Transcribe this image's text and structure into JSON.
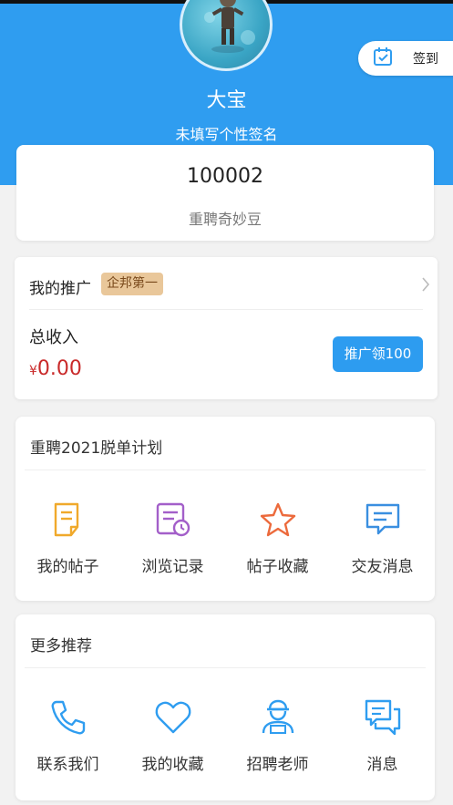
{
  "profile": {
    "nickname": "大宝",
    "signature": "未填写个性签名"
  },
  "signin": {
    "label": "签到",
    "icon": "calendar-check-icon"
  },
  "beans": {
    "value": "100002",
    "label": "重聘奇妙豆"
  },
  "promotion": {
    "title": "我的推广",
    "badge": "企邦第一",
    "income_label": "总收入",
    "currency": "¥",
    "income_value": "0.00",
    "button_label": "推广领100"
  },
  "plan": {
    "title": "重聘2021脱单计划",
    "items": [
      {
        "label": "我的帖子",
        "icon": "document-icon"
      },
      {
        "label": "浏览记录",
        "icon": "history-icon"
      },
      {
        "label": "帖子收藏",
        "icon": "star-icon"
      },
      {
        "label": "交友消息",
        "icon": "chat-icon"
      }
    ]
  },
  "more": {
    "title": "更多推荐",
    "items": [
      {
        "label": "联系我们",
        "icon": "phone-icon"
      },
      {
        "label": "我的收藏",
        "icon": "heart-icon"
      },
      {
        "label": "招聘老师",
        "icon": "teacher-icon"
      },
      {
        "label": "消息",
        "icon": "messages-icon"
      }
    ]
  },
  "colors": {
    "header": "#2f9df0",
    "accent": "#2d9cf0",
    "income": "#c92a2a",
    "badge": "#e9c79a"
  }
}
